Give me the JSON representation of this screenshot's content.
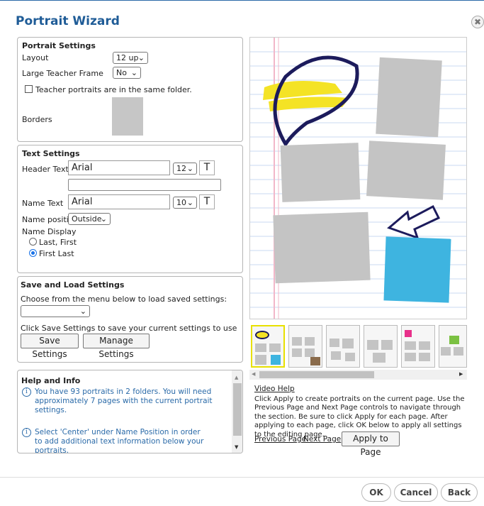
{
  "window": {
    "title": "Portrait Wizard",
    "close_symbol": "✖"
  },
  "portrait_settings": {
    "heading": "Portrait Settings",
    "layout_label": "Layout",
    "layout_value": "12 up",
    "large_teacher_label": "Large Teacher Frame",
    "large_teacher_value": "No",
    "teacher_folder_label": "Teacher portraits are in the same folder.",
    "borders_label": "Borders"
  },
  "text_settings": {
    "heading": "Text Settings",
    "header_text_label": "Header Text",
    "header_font": "Arial",
    "header_size": "12",
    "header_text_value": "",
    "name_text_label": "Name Text",
    "name_font": "Arial",
    "name_size": "10",
    "t_label": "T",
    "name_position_label": "Name position",
    "name_position_value": "Outside",
    "name_display_label": "Name Display",
    "option_last_first": "Last, First",
    "option_first_last": "First Last"
  },
  "save_load": {
    "heading": "Save and Load Settings",
    "choose_label": "Choose from the menu below to load saved settings:",
    "saved_value": "",
    "save_hint": "Click Save Settings to save your current settings to use later.",
    "save_button": "Save Settings",
    "manage_button": "Manage Settings"
  },
  "help": {
    "heading": "Help and Info",
    "info1": "You have 93 portraits in 2 folders. You will need approximately 7 pages with the current portrait settings.",
    "info2": "Select 'Center' under Name Position in order to add additional text information below your portraits."
  },
  "preview": {
    "video_help": "Video Help",
    "instructions": "Click Apply to create portraits on the current page. Use the Previous Page and Next Page controls to navigate through the section. Be sure to click Apply for each page. After applying to each page, click OK below to apply all settings to the editing page.",
    "previous_page": "Previous Page",
    "next_page": "Next Page",
    "apply_button": "Apply to Page"
  },
  "footer": {
    "ok": "OK",
    "cancel": "Cancel",
    "back": "Back"
  },
  "icons": {
    "chevron": "⌄",
    "info": "i",
    "scroll_up": "▲",
    "scroll_down": "▼",
    "scroll_left": "◀",
    "scroll_right": "▶"
  }
}
